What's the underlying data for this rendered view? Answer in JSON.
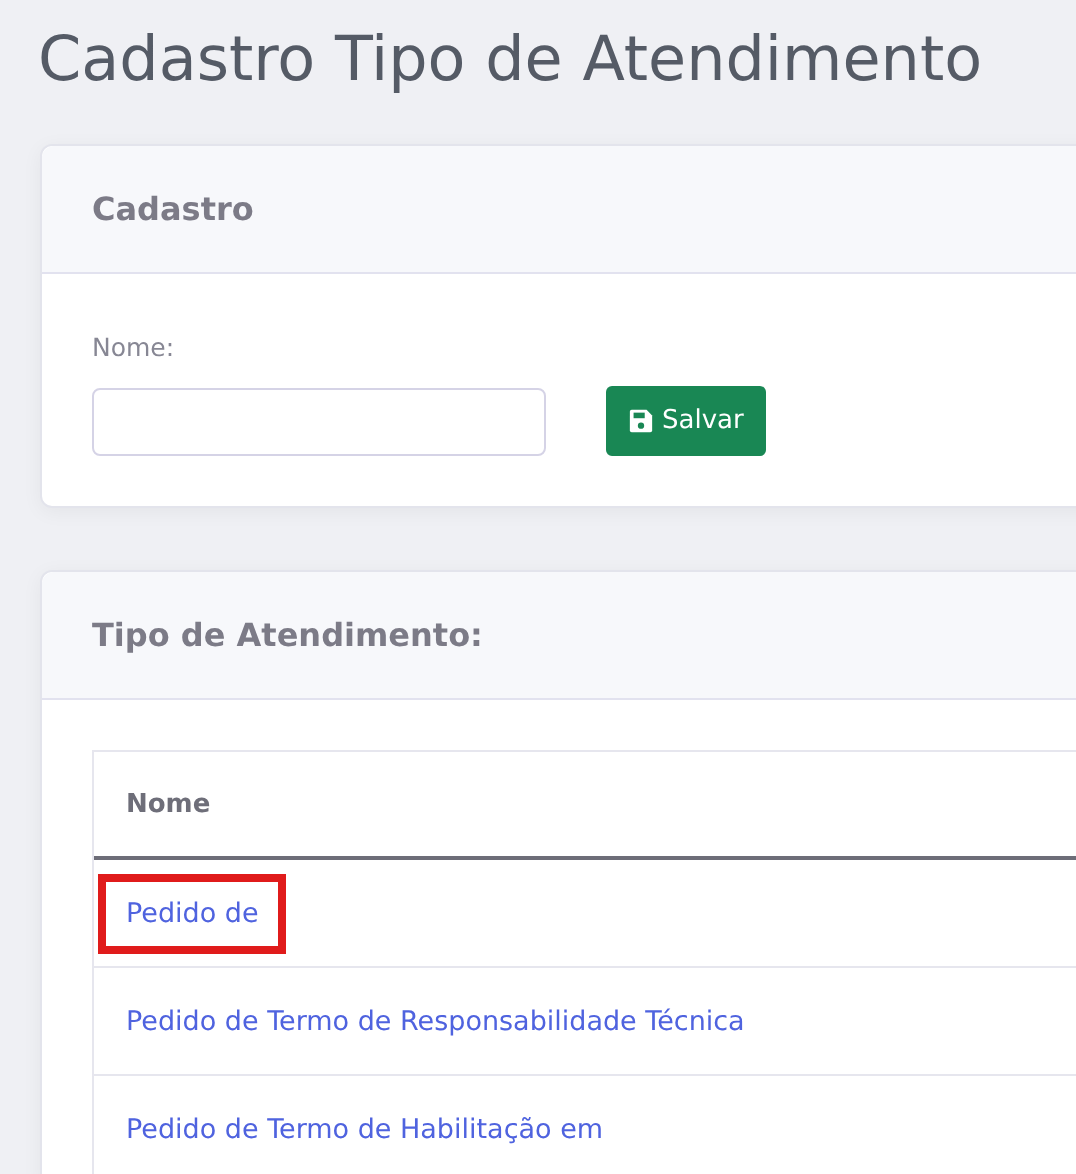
{
  "page_title": "Cadastro Tipo de Atendimento",
  "form_card": {
    "title": "Cadastro",
    "field_label": "Nome:",
    "save_button": "Salvar"
  },
  "list_card": {
    "title": "Tipo de Atendimento:",
    "table": {
      "columns": [
        "Nome"
      ],
      "rows": [
        {
          "name": "Pedido de",
          "highlighted": true
        },
        {
          "name": "Pedido de Termo de Responsabilidade Técnica",
          "highlighted": false
        },
        {
          "name": "Pedido de Termo de Habilitação em",
          "highlighted": false
        }
      ]
    }
  }
}
